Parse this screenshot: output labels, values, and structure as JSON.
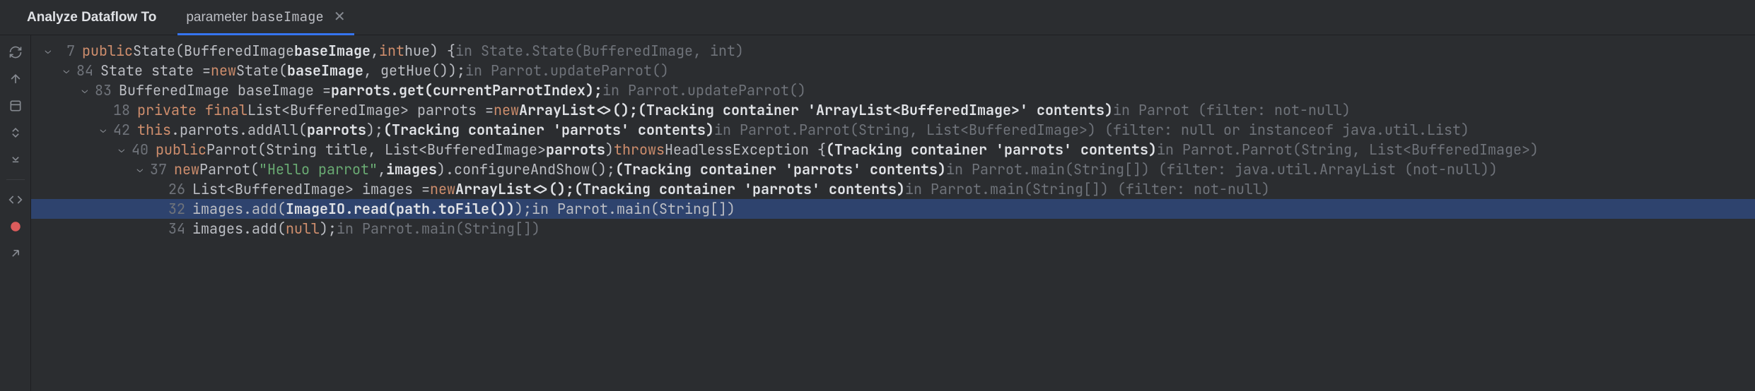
{
  "header": {
    "title": "Analyze Dataflow To",
    "tab_prefix": "parameter ",
    "tab_name": "baseImage"
  },
  "rows": [
    {
      "indent": 0,
      "chevron": "open",
      "line": "7",
      "selected": false,
      "segments": [
        {
          "t": "public ",
          "c": "kw"
        },
        {
          "t": "State(BufferedImage ",
          "c": "code"
        },
        {
          "t": "baseImage",
          "c": "bold"
        },
        {
          "t": ", ",
          "c": "code"
        },
        {
          "t": "int ",
          "c": "kw"
        },
        {
          "t": "hue) { ",
          "c": "code"
        },
        {
          "t": "in State.State(BufferedImage, int)",
          "c": "ctx"
        }
      ]
    },
    {
      "indent": 1,
      "chevron": "open",
      "line": "84",
      "selected": false,
      "segments": [
        {
          "t": "State state = ",
          "c": "code"
        },
        {
          "t": "new ",
          "c": "kw"
        },
        {
          "t": "State(",
          "c": "code"
        },
        {
          "t": "baseImage",
          "c": "bold"
        },
        {
          "t": ", getHue()); ",
          "c": "code"
        },
        {
          "t": "in Parrot.updateParrot()",
          "c": "ctx"
        }
      ]
    },
    {
      "indent": 2,
      "chevron": "open",
      "line": "83",
      "selected": false,
      "segments": [
        {
          "t": "BufferedImage baseImage = ",
          "c": "code"
        },
        {
          "t": "parrots.get(currentParrotIndex);",
          "c": "bold"
        },
        {
          "t": " in Parrot.updateParrot()",
          "c": "ctx"
        }
      ]
    },
    {
      "indent": 3,
      "chevron": "none",
      "line": "18",
      "selected": false,
      "segments": [
        {
          "t": "private final ",
          "c": "kw"
        },
        {
          "t": "List<BufferedImage> parrots = ",
          "c": "code"
        },
        {
          "t": "new ",
          "c": "kw"
        },
        {
          "t": "ArrayList<>();",
          "c": "bold"
        },
        {
          "t": " (Tracking container 'ArrayList<BufferedImage>' contents)",
          "c": "bold"
        },
        {
          "t": " in Parrot (filter: not-null)",
          "c": "ctx"
        }
      ]
    },
    {
      "indent": 3,
      "chevron": "open",
      "line": "42",
      "selected": false,
      "segments": [
        {
          "t": "this",
          "c": "kw"
        },
        {
          "t": ".parrots.addAll(",
          "c": "code"
        },
        {
          "t": "parrots",
          "c": "bold"
        },
        {
          "t": "); ",
          "c": "code"
        },
        {
          "t": "(Tracking container 'parrots' contents)",
          "c": "bold"
        },
        {
          "t": " in Parrot.Parrot(String, List<BufferedImage>) (filter: null or instanceof java.util.List)",
          "c": "ctx"
        }
      ]
    },
    {
      "indent": 4,
      "chevron": "open",
      "line": "40",
      "selected": false,
      "segments": [
        {
          "t": "public ",
          "c": "kw"
        },
        {
          "t": "Parrot(String title, List<BufferedImage> ",
          "c": "code"
        },
        {
          "t": "parrots",
          "c": "bold"
        },
        {
          "t": ") ",
          "c": "code"
        },
        {
          "t": "throws ",
          "c": "kw"
        },
        {
          "t": "HeadlessException { ",
          "c": "code"
        },
        {
          "t": "(Tracking container 'parrots' contents)",
          "c": "bold"
        },
        {
          "t": " in Parrot.Parrot(String, List<BufferedImage>)",
          "c": "ctx"
        }
      ]
    },
    {
      "indent": 5,
      "chevron": "open",
      "line": "37",
      "selected": false,
      "segments": [
        {
          "t": "new ",
          "c": "kw"
        },
        {
          "t": "Parrot(",
          "c": "code"
        },
        {
          "t": "\"Hello parrot\"",
          "c": "str"
        },
        {
          "t": ", ",
          "c": "code"
        },
        {
          "t": "images",
          "c": "bold"
        },
        {
          "t": ").configureAndShow(); ",
          "c": "code"
        },
        {
          "t": "(Tracking container 'parrots' contents)",
          "c": "bold"
        },
        {
          "t": " in Parrot.main(String[]) (filter: java.util.ArrayList (not-null))",
          "c": "ctx"
        }
      ]
    },
    {
      "indent": 6,
      "chevron": "none",
      "line": "26",
      "selected": false,
      "segments": [
        {
          "t": "List<BufferedImage> images = ",
          "c": "code"
        },
        {
          "t": "new ",
          "c": "kw"
        },
        {
          "t": "ArrayList<>();",
          "c": "bold"
        },
        {
          "t": " (Tracking container 'parrots' contents)",
          "c": "bold"
        },
        {
          "t": " in Parrot.main(String[]) (filter: not-null)",
          "c": "ctx"
        }
      ]
    },
    {
      "indent": 6,
      "chevron": "none",
      "line": "32",
      "selected": true,
      "segments": [
        {
          "t": "images.add(",
          "c": "code"
        },
        {
          "t": "ImageIO.read(path.toFile())",
          "c": "bold"
        },
        {
          "t": "); ",
          "c": "code"
        },
        {
          "t": "in Parrot.main(String[])",
          "c": "ctx-norm"
        }
      ]
    },
    {
      "indent": 6,
      "chevron": "none",
      "line": "34",
      "selected": false,
      "segments": [
        {
          "t": "images.add(",
          "c": "code"
        },
        {
          "t": "null",
          "c": "kw"
        },
        {
          "t": "); ",
          "c": "code"
        },
        {
          "t": "in Parrot.main(String[])",
          "c": "ctx"
        }
      ]
    }
  ]
}
